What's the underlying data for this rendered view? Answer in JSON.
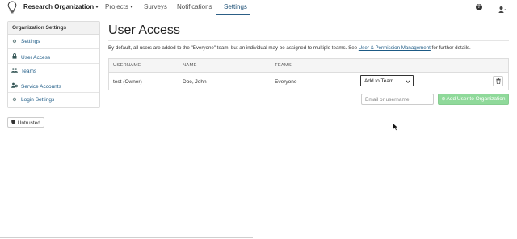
{
  "topnav": {
    "org_name": "Research Organization",
    "items": [
      {
        "label": "Projects"
      },
      {
        "label": "Surveys"
      },
      {
        "label": "Notifications"
      },
      {
        "label": "Settings"
      }
    ],
    "help_icon": "question-circle-icon",
    "user_icon": "user-icon"
  },
  "sidebar": {
    "heading": "Organization Settings",
    "items": [
      {
        "label": "Settings",
        "icon": "gear-icon"
      },
      {
        "label": "User Access",
        "icon": "lock-icon"
      },
      {
        "label": "Teams",
        "icon": "users-icon"
      },
      {
        "label": "Service Accounts",
        "icon": "service-accounts-icon"
      },
      {
        "label": "Login Settings",
        "icon": "gears-icon"
      }
    ],
    "badge_label": "Untrusted",
    "badge_icon": "shield-icon"
  },
  "main": {
    "title": "User Access",
    "description_before": "By default, all users are added to the \"Everyone\" team, but an individual may be assigned to multiple teams. See ",
    "description_link": "User & Permission Management",
    "description_after": " for further details.",
    "table": {
      "columns": [
        "USERNAME",
        "NAME",
        "TEAMS"
      ],
      "rows": [
        {
          "username": "test (Owner)",
          "name": "Doe, John",
          "teams": "Everyone",
          "select_value": "Add to Team"
        }
      ]
    },
    "add_user": {
      "placeholder": "Email or username",
      "button_label": "Add User to Organization",
      "button_color": "#8fd99a"
    }
  },
  "colors": {
    "accent": "#2c5f86",
    "link": "#1c5a85"
  }
}
